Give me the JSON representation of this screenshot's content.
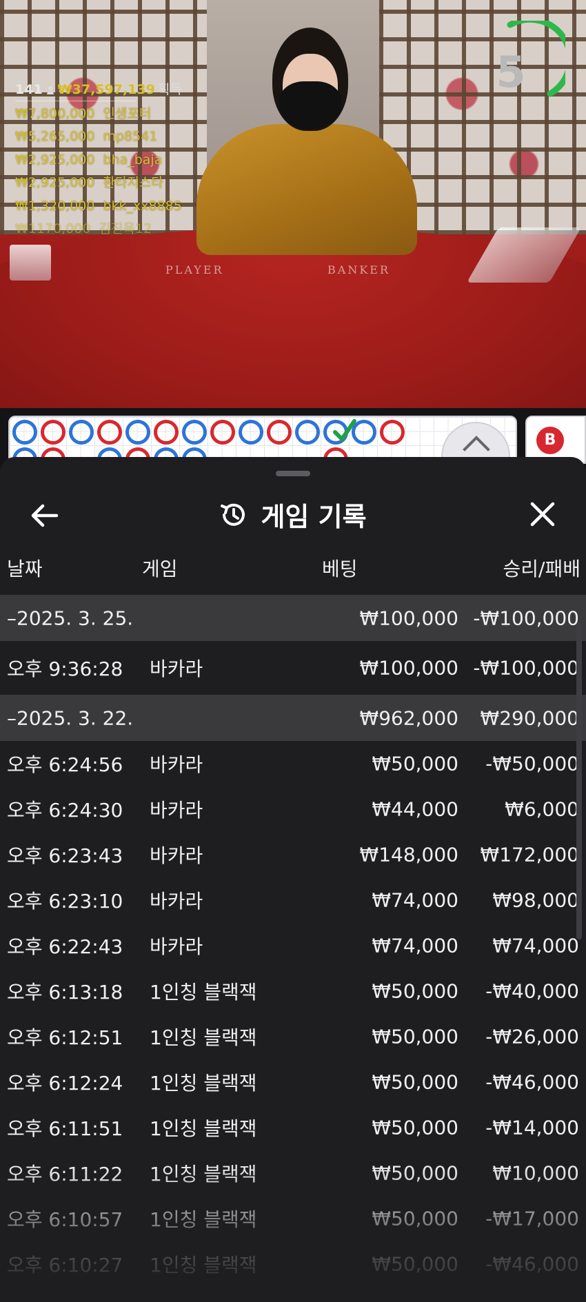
{
  "winners": {
    "count": "141",
    "total": "₩37,597,139",
    "suffix": "획득",
    "list": [
      {
        "amount": "₩7,800,000",
        "name": "인생포터"
      },
      {
        "amount": "₩5,265,000",
        "name": "mp8541"
      },
      {
        "amount": "₩2,925,000",
        "name": "bha_baja"
      },
      {
        "amount": "₩2,925,000",
        "name": "환타지스타"
      },
      {
        "amount": "₩1,320,000",
        "name": "bkk_xx8885"
      },
      {
        "amount": "₩1170,000",
        "name": "김진욱12"
      }
    ]
  },
  "table_labels": {
    "player": "PLAYER",
    "banker": "BANKER"
  },
  "timer": {
    "value": "5",
    "color": "#2fb84a"
  },
  "roadmap": {
    "badge": "B"
  },
  "sheet": {
    "title": "게임 기록",
    "columns": {
      "date": "날짜",
      "game": "게임",
      "bet": "베팅",
      "result": "승리/패배"
    },
    "groups": [
      {
        "date": "–2025. 3. 25.",
        "bet": "₩100,000",
        "result": "-₩100,000",
        "items": [
          {
            "time": "오후 9:36:28",
            "game": "바카라",
            "bet": "₩100,000",
            "result": "-₩100,000"
          }
        ]
      },
      {
        "date": "–2025. 3. 22.",
        "bet": "₩962,000",
        "result": "₩290,000",
        "items": [
          {
            "time": "오후 6:24:56",
            "game": "바카라",
            "bet": "₩50,000",
            "result": "-₩50,000"
          },
          {
            "time": "오후 6:24:30",
            "game": "바카라",
            "bet": "₩44,000",
            "result": "₩6,000"
          },
          {
            "time": "오후 6:23:43",
            "game": "바카라",
            "bet": "₩148,000",
            "result": "₩172,000"
          },
          {
            "time": "오후 6:23:10",
            "game": "바카라",
            "bet": "₩74,000",
            "result": "₩98,000"
          },
          {
            "time": "오후 6:22:43",
            "game": "바카라",
            "bet": "₩74,000",
            "result": "₩74,000"
          },
          {
            "time": "오후 6:13:18",
            "game": "1인칭 블랙잭",
            "bet": "₩50,000",
            "result": "-₩40,000"
          },
          {
            "time": "오후 6:12:51",
            "game": "1인칭 블랙잭",
            "bet": "₩50,000",
            "result": "-₩26,000"
          },
          {
            "time": "오후 6:12:24",
            "game": "1인칭 블랙잭",
            "bet": "₩50,000",
            "result": "-₩46,000"
          },
          {
            "time": "오후 6:11:51",
            "game": "1인칭 블랙잭",
            "bet": "₩50,000",
            "result": "-₩14,000"
          },
          {
            "time": "오후 6:11:22",
            "game": "1인칭 블랙잭",
            "bet": "₩50,000",
            "result": "₩10,000"
          },
          {
            "time": "오후 6:10:57",
            "game": "1인칭 블랙잭",
            "bet": "₩50,000",
            "result": "-₩17,000"
          },
          {
            "time": "오후 6:10:27",
            "game": "1인칭 블랙잭",
            "bet": "₩50,000",
            "result": "-₩46,000"
          }
        ]
      }
    ]
  }
}
